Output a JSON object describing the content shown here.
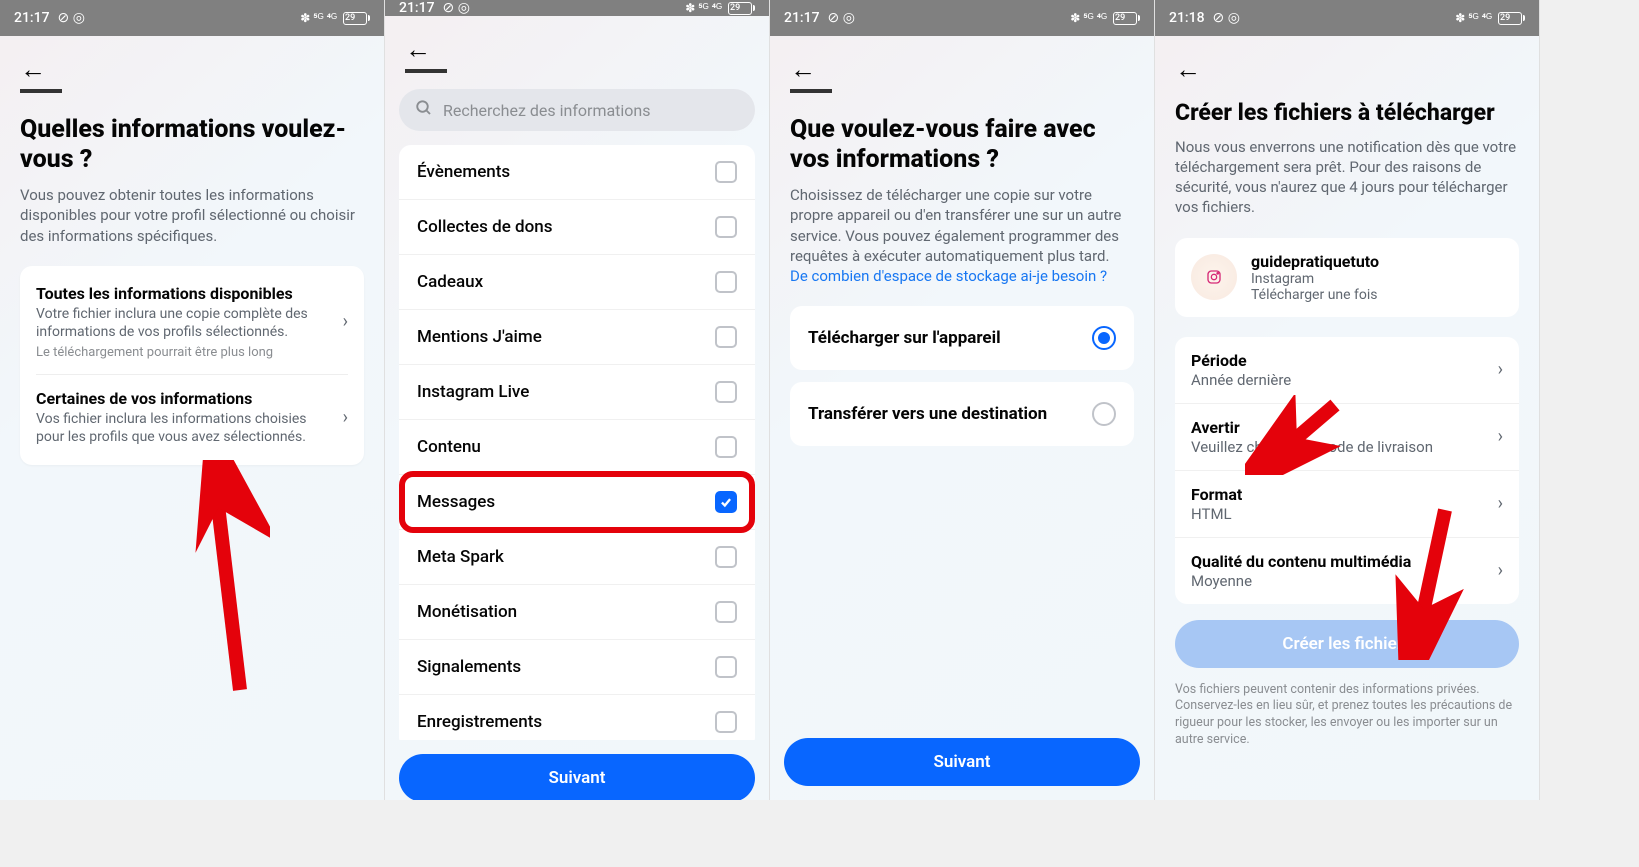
{
  "statusbar": {
    "time_a": "21:17",
    "time_b": "21:18",
    "icons_left": "⊘ ◎",
    "icons_right": "✽ ⁵ᴳ ⁴ᴳ",
    "battery": "29"
  },
  "screen1": {
    "title": "Quelles informations voulez-vous ?",
    "subtitle": "Vous pouvez obtenir toutes les informations disponibles pour votre profil sélectionné ou choisir des informations spécifiques.",
    "opt1_title": "Toutes les informations disponibles",
    "opt1_desc": "Votre fichier inclura une copie complète des informations de vos profils sélectionnés.",
    "opt1_note": "Le téléchargement pourrait être plus long",
    "opt2_title": "Certaines de vos informations",
    "opt2_desc": "Vos fichier inclura les informations choisies pour les profils que vous avez sélectionnés."
  },
  "screen2": {
    "search_placeholder": "Recherchez des informations",
    "items": [
      {
        "label": "Évènements",
        "checked": false
      },
      {
        "label": "Collectes de dons",
        "checked": false
      },
      {
        "label": "Cadeaux",
        "checked": false
      },
      {
        "label": "Mentions J'aime",
        "checked": false
      },
      {
        "label": "Instagram Live",
        "checked": false
      },
      {
        "label": "Contenu",
        "checked": false
      },
      {
        "label": "Messages",
        "checked": true
      },
      {
        "label": "Meta Spark",
        "checked": false
      },
      {
        "label": "Monétisation",
        "checked": false
      },
      {
        "label": "Signalements",
        "checked": false
      },
      {
        "label": "Enregistrements",
        "checked": false
      }
    ],
    "next": "Suivant"
  },
  "screen3": {
    "title": "Que voulez-vous faire avec vos informations ?",
    "subtitle": "Choisissez de télécharger une copie sur votre propre appareil ou d'en transférer une sur un autre service. Vous pouvez également programmer des requêtes à exécuter automatiquement plus tard.",
    "link": "De combien d'espace de stockage ai-je besoin ?",
    "opt1": "Télécharger sur l'appareil",
    "opt2": "Transférer vers une destination",
    "next": "Suivant"
  },
  "screen4": {
    "title": "Créer les fichiers à télécharger",
    "subtitle": "Nous vous enverrons une notification dès que votre téléchargement sera prêt. Pour des raisons de sécurité, vous n'aurez que 4 jours pour télécharger vos fichiers.",
    "account_name": "guidepratiquetuto",
    "account_platform": "Instagram",
    "account_note": "Télécharger une fois",
    "rows": [
      {
        "t": "Période",
        "v": "Année dernière"
      },
      {
        "t": "Avertir",
        "v": "Veuillez choisir un mode de livraison"
      },
      {
        "t": "Format",
        "v": "HTML"
      },
      {
        "t": "Qualité du contenu multimédia",
        "v": "Moyenne"
      }
    ],
    "cta": "Créer les fichiers",
    "footnote": "Vos fichiers peuvent contenir des informations privées. Conservez-les en lieu sûr, et prenez toutes les précautions de rigueur pour les stocker, les envoyer ou les importer sur un autre service."
  }
}
